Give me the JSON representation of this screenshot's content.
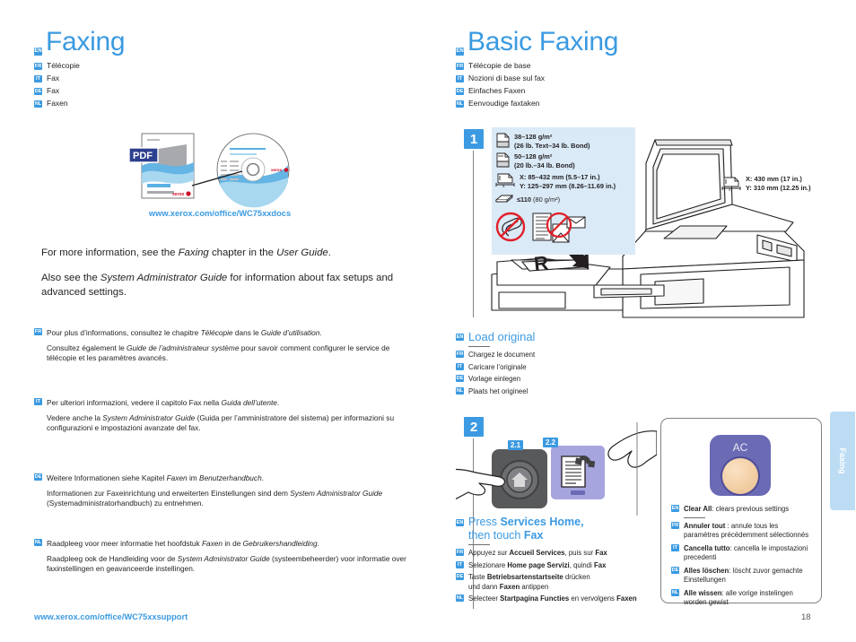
{
  "left": {
    "title": {
      "badge": "EN",
      "text": "Faxing"
    },
    "translations": [
      {
        "badge": "FR",
        "text": "Télécopie"
      },
      {
        "badge": "IT",
        "text": "Fax"
      },
      {
        "badge": "DE",
        "text": "Fax"
      },
      {
        "badge": "NL",
        "text": "Faxen"
      }
    ],
    "docs_url": "www.xerox.com/office/WC75xxdocs",
    "docs_icon_label": "PDF",
    "en_paragraphs": [
      "For more information, see the <em>Faxing</em> chapter in the <em>User Guide</em>.",
      "Also see the <em>System Administrator Guide</em> for information about fax setups and advanced settings."
    ],
    "localized": [
      {
        "badge": "FR",
        "head": "Pour plus d’informations, consultez le chapitre <em>Télécopie</em> dans le <em>Guide d’utilisation</em>.",
        "body": "Consultez également le <em>Guide de l’administrateur système</em> pour savoir comment configurer le service de télécopie et les paramètres avancés."
      },
      {
        "badge": "IT",
        "head": "Per ulteriori informazioni, vedere il capitolo Fax nella <em>Guida dell’utente</em>.",
        "body": "Vedere anche la <em>System Administrator Guide</em> (Guida per l’amministratore del sistema) per informazioni su configurazioni e impostazioni avanzate del fax."
      },
      {
        "badge": "DE",
        "head": "Weitere Informationen siehe Kapitel <em>Faxen</em> im <em>Benutzerhandbuch</em>.",
        "body": "Informationen zur Faxeinrichtung und erweiterten Einstellungen sind dem <em>System Administrator Guide</em> (Systemadministratorhandbuch) zu entnehmen."
      },
      {
        "badge": "NL",
        "head": "Raadpleeg voor meer informatie het hoofdstuk <em>Faxen</em> in de <em>Gebruikershandleiding</em>.",
        "body": "Raadpleeg ook de Handleiding voor de <em>System Administrator Guide</em> (systeembeheerder) voor informatie over faxinstellingen en geavanceerde instellingen."
      }
    ],
    "footer_url": "www.xerox.com/office/WC75xxsupport"
  },
  "right": {
    "title": {
      "badge": "EN",
      "text": "Basic Faxing"
    },
    "translations": [
      {
        "badge": "FR",
        "text": "Télécopie de base"
      },
      {
        "badge": "IT",
        "text": "Nozioni di base sul fax"
      },
      {
        "badge": "DE",
        "text": "Einfaches Faxen"
      },
      {
        "badge": "NL",
        "text": "Eenvoudige faxtaken"
      }
    ],
    "step1": {
      "number": "1",
      "specs": [
        {
          "icon": "single-sheet-icon",
          "line1": "38–128 g/m²",
          "line2": "(26 lb. Text–34 lb. Bond)"
        },
        {
          "icon": "double-sheet-icon",
          "line1": "50–128 g/m²",
          "line2": "(20 lb.–34 lb. Bond)"
        }
      ],
      "size_spec": {
        "icon": "sheet-dimensions-icon",
        "x": "X: 85–432 mm (5.5–17 in.)",
        "y": "Y: 125–297 mm (8.26–11.69 in.)"
      },
      "stack_spec": {
        "icon": "paper-stack-icon",
        "bold": "≤110",
        "rest": "(80 g/m²)"
      },
      "prohibited": [
        "no-paperclips-icon",
        "no-stapled-or-folded-originals-icon"
      ],
      "glass_spec": {
        "icon": "glass-dimensions-icon",
        "x": "X: 430 mm (17 in.)",
        "y": "Y: 310 mm (12.25 in.)"
      },
      "caption": {
        "badge": "EN",
        "text": "Load original",
        "translations": [
          {
            "badge": "FR",
            "text": "Chargez le document"
          },
          {
            "badge": "IT",
            "text": "Caricare l’originale"
          },
          {
            "badge": "DE",
            "text": "Vorlage einlegen"
          },
          {
            "badge": "NL",
            "text": "Plaats het origineel"
          }
        ]
      }
    },
    "step2": {
      "number": "2",
      "sub1": "2.1",
      "sub2": "2.2",
      "caption": {
        "badge": "EN",
        "line1_pre": "Press ",
        "line1_bold": "Services Home,",
        "line2_pre": "then touch ",
        "line2_bold": "Fax",
        "translations": [
          {
            "badge": "FR",
            "html": "Appuyez sur <b>Accueil Services</b>, puis sur <b>Fax</b>"
          },
          {
            "badge": "IT",
            "html": "Selezionare <b>Home page Servizi</b>, quindi <b>Fax</b>"
          },
          {
            "badge": "DE",
            "html": "Taste <b>Betriebsartenstartseite</b> drücken<br>und dann <b>Faxen</b> antippen"
          },
          {
            "badge": "NL",
            "html": "Selecteer <b>Startpagina Functies</b> en vervolgens <b>Faxen</b>"
          }
        ]
      }
    },
    "clear_all": {
      "key_label": "AC",
      "items": [
        {
          "badge": "EN",
          "html": "<b>Clear All</b>: clears previous settings"
        },
        {
          "badge": "FR",
          "html": "<b>Annuler tout</b> : annule tous les paramètres précédemment sélectionnés"
        },
        {
          "badge": "IT",
          "html": "<b>Cancella tutto</b>: cancella le impostazioni precedenti"
        },
        {
          "badge": "DE",
          "html": "<b>Alles löschen</b>: löscht zuvor gemachte Einstellungen"
        },
        {
          "badge": "NL",
          "html": "<b>Alle wissen</b>: alle vorige instelingen worden gewist"
        }
      ]
    },
    "side_tab": "Faxing",
    "page_number": "18"
  },
  "colors": {
    "accent": "#3b9ae1",
    "panel": "#daeaf7",
    "side_tab": "#bcdcf3",
    "text": "#231f20",
    "key_purple": "#6b6ab5",
    "prohibit_red": "#e0202a"
  }
}
